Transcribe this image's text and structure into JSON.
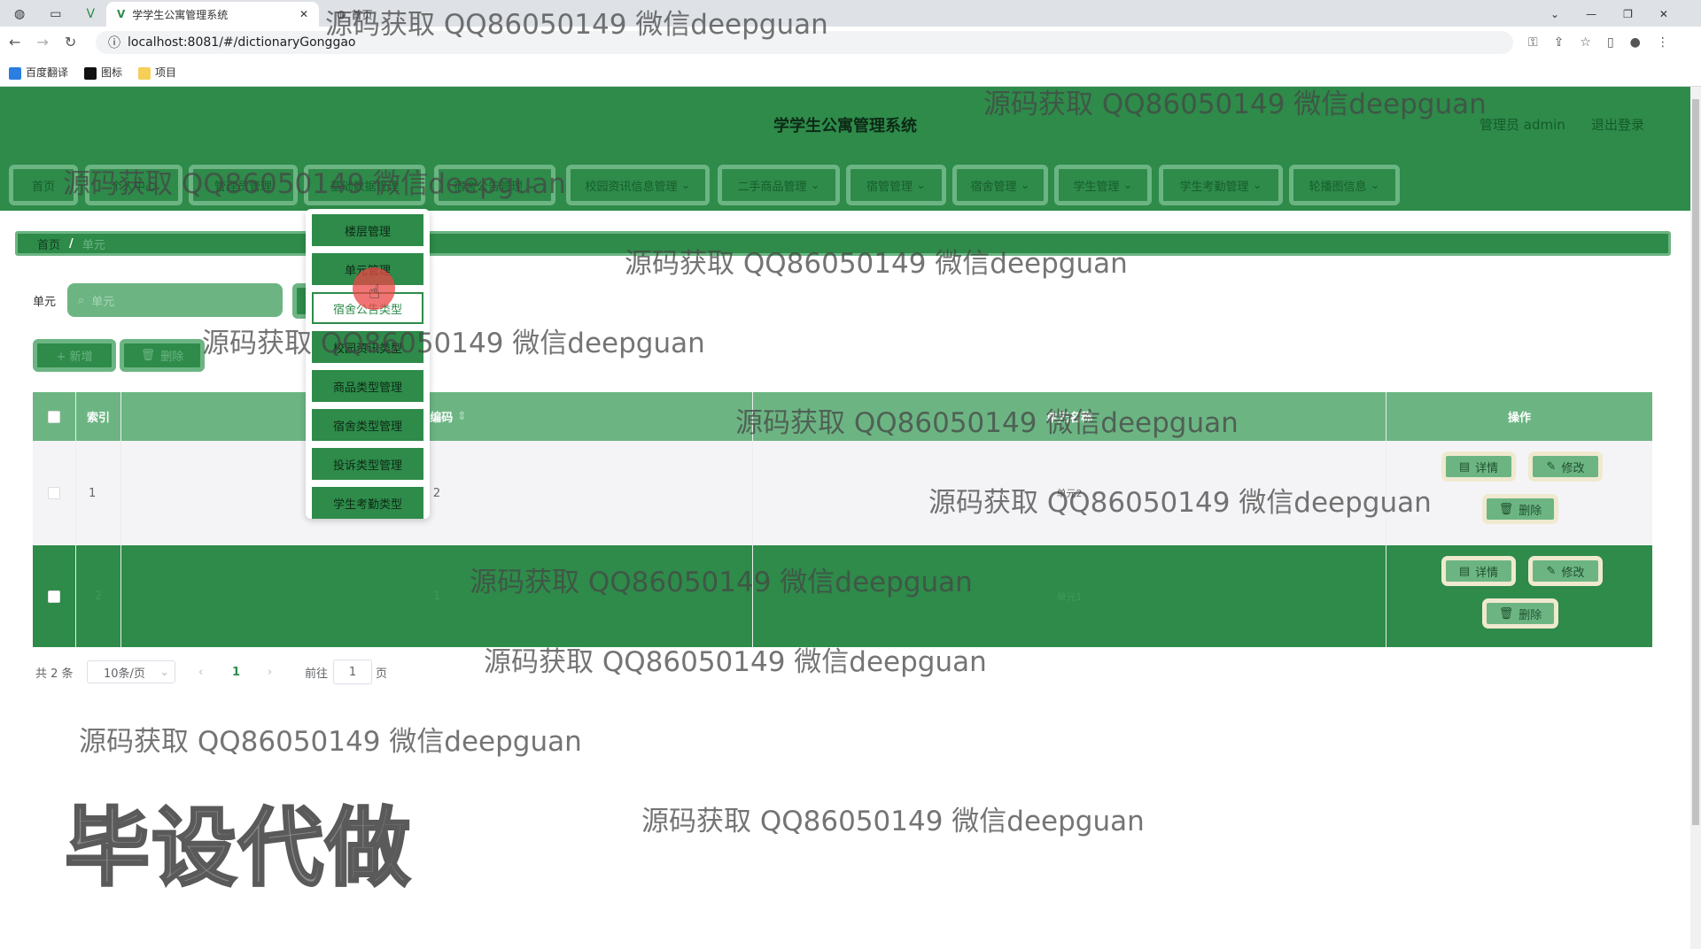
{
  "browser": {
    "tab_title": "学学生公寓管理系统",
    "tab2_title": "首页",
    "url": "localhost:8081/#/dictionaryGonggao",
    "bookmarks": [
      "百度翻译",
      "图标",
      "项目"
    ]
  },
  "header": {
    "title": "学学生公寓管理系统",
    "user": "管理员 admin",
    "logout": "退出登录"
  },
  "nav": [
    "首页",
    "个人中心",
    "管理员管理",
    "基础数据管理",
    "宿舍公告管理",
    "校园资讯信息管理",
    "二手商品管理",
    "宿管管理",
    "宿舍管理",
    "学生管理",
    "学生考勤管理",
    "轮播图信息"
  ],
  "dropdown": [
    "楼层管理",
    "单元管理",
    "宿舍公告类型",
    "校园资讯类型",
    "商品类型管理",
    "宿舍类型管理",
    "投诉类型管理",
    "学生考勤类型"
  ],
  "breadcrumb": {
    "home": "首页",
    "sep": "/",
    "current": "单元"
  },
  "search": {
    "label": "单元",
    "placeholder": "单元"
  },
  "actions": {
    "add": "+ 新增",
    "delete": "删除"
  },
  "table": {
    "headers": [
      "索引",
      "单元编码",
      "单元名称",
      "操作"
    ],
    "rows": [
      {
        "index": "1",
        "code": "2",
        "name": "单元2"
      },
      {
        "index": "2",
        "code": "1",
        "name": "单元1"
      }
    ],
    "row_buttons": {
      "detail": "详情",
      "edit": "修改",
      "delete": "删除"
    }
  },
  "pagination": {
    "total": "共 2 条",
    "page_size": "10条/页",
    "current": "1",
    "goto": "前往",
    "goto_value": "1",
    "page_unit": "页"
  },
  "watermark": {
    "text": "源码获取 QQ86050149 微信deepguan",
    "big": "毕设代做"
  },
  "colors": {
    "primary": "#2e8b4a",
    "light": "#6cb583"
  }
}
